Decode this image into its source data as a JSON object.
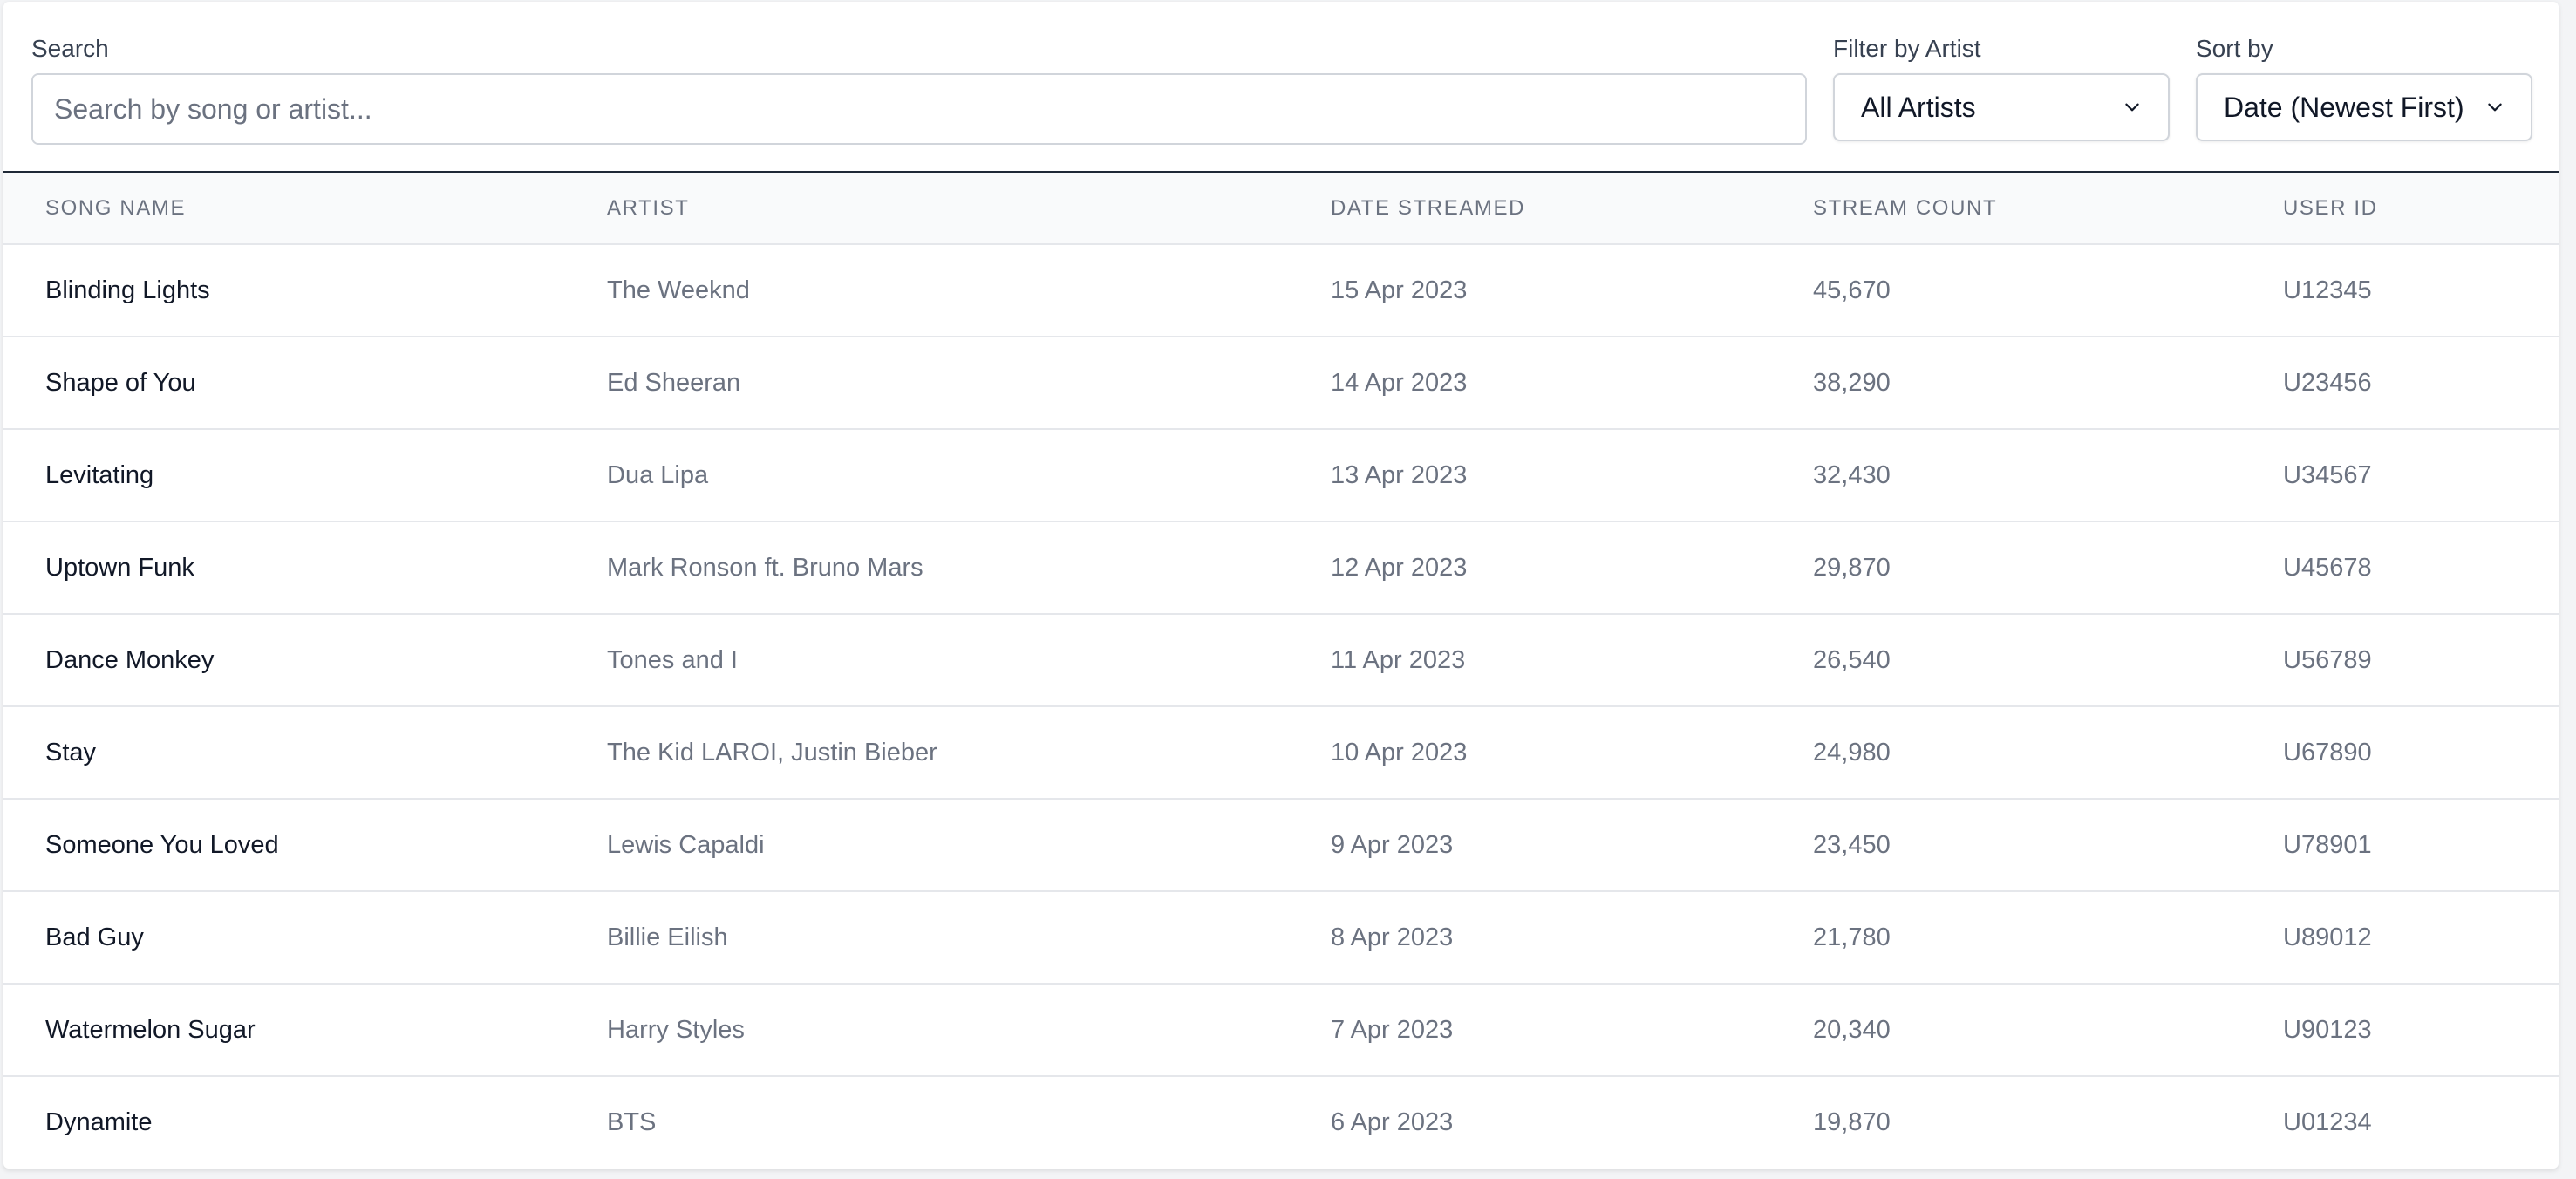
{
  "controls": {
    "search_label": "Search",
    "search_placeholder": "Search by song or artist...",
    "search_value": "",
    "artist_label": "Filter by Artist",
    "artist_selected": "All Artists",
    "sort_label": "Sort by",
    "sort_selected": "Date (Newest First)"
  },
  "table": {
    "headers": [
      "SONG NAME",
      "ARTIST",
      "DATE STREAMED",
      "STREAM COUNT",
      "USER ID"
    ],
    "rows": [
      [
        "Blinding Lights",
        "The Weeknd",
        "15 Apr 2023",
        "45,670",
        "U12345"
      ],
      [
        "Shape of You",
        "Ed Sheeran",
        "14 Apr 2023",
        "38,290",
        "U23456"
      ],
      [
        "Levitating",
        "Dua Lipa",
        "13 Apr 2023",
        "32,430",
        "U34567"
      ],
      [
        "Uptown Funk",
        "Mark Ronson ft. Bruno Mars",
        "12 Apr 2023",
        "29,870",
        "U45678"
      ],
      [
        "Dance Monkey",
        "Tones and I",
        "11 Apr 2023",
        "26,540",
        "U56789"
      ],
      [
        "Stay",
        "The Kid LAROI, Justin Bieber",
        "10 Apr 2023",
        "24,980",
        "U67890"
      ],
      [
        "Someone You Loved",
        "Lewis Capaldi",
        "9 Apr 2023",
        "23,450",
        "U78901"
      ],
      [
        "Bad Guy",
        "Billie Eilish",
        "8 Apr 2023",
        "21,780",
        "U89012"
      ],
      [
        "Watermelon Sugar",
        "Harry Styles",
        "7 Apr 2023",
        "20,340",
        "U90123"
      ],
      [
        "Dynamite",
        "BTS",
        "6 Apr 2023",
        "19,870",
        "U01234"
      ]
    ]
  },
  "icons": {
    "select_chevron": "chevron-down-icon"
  },
  "colors": {
    "divider": "#1f2937",
    "header_bg": "#f9fafb",
    "muted_text": "#6b7280"
  }
}
